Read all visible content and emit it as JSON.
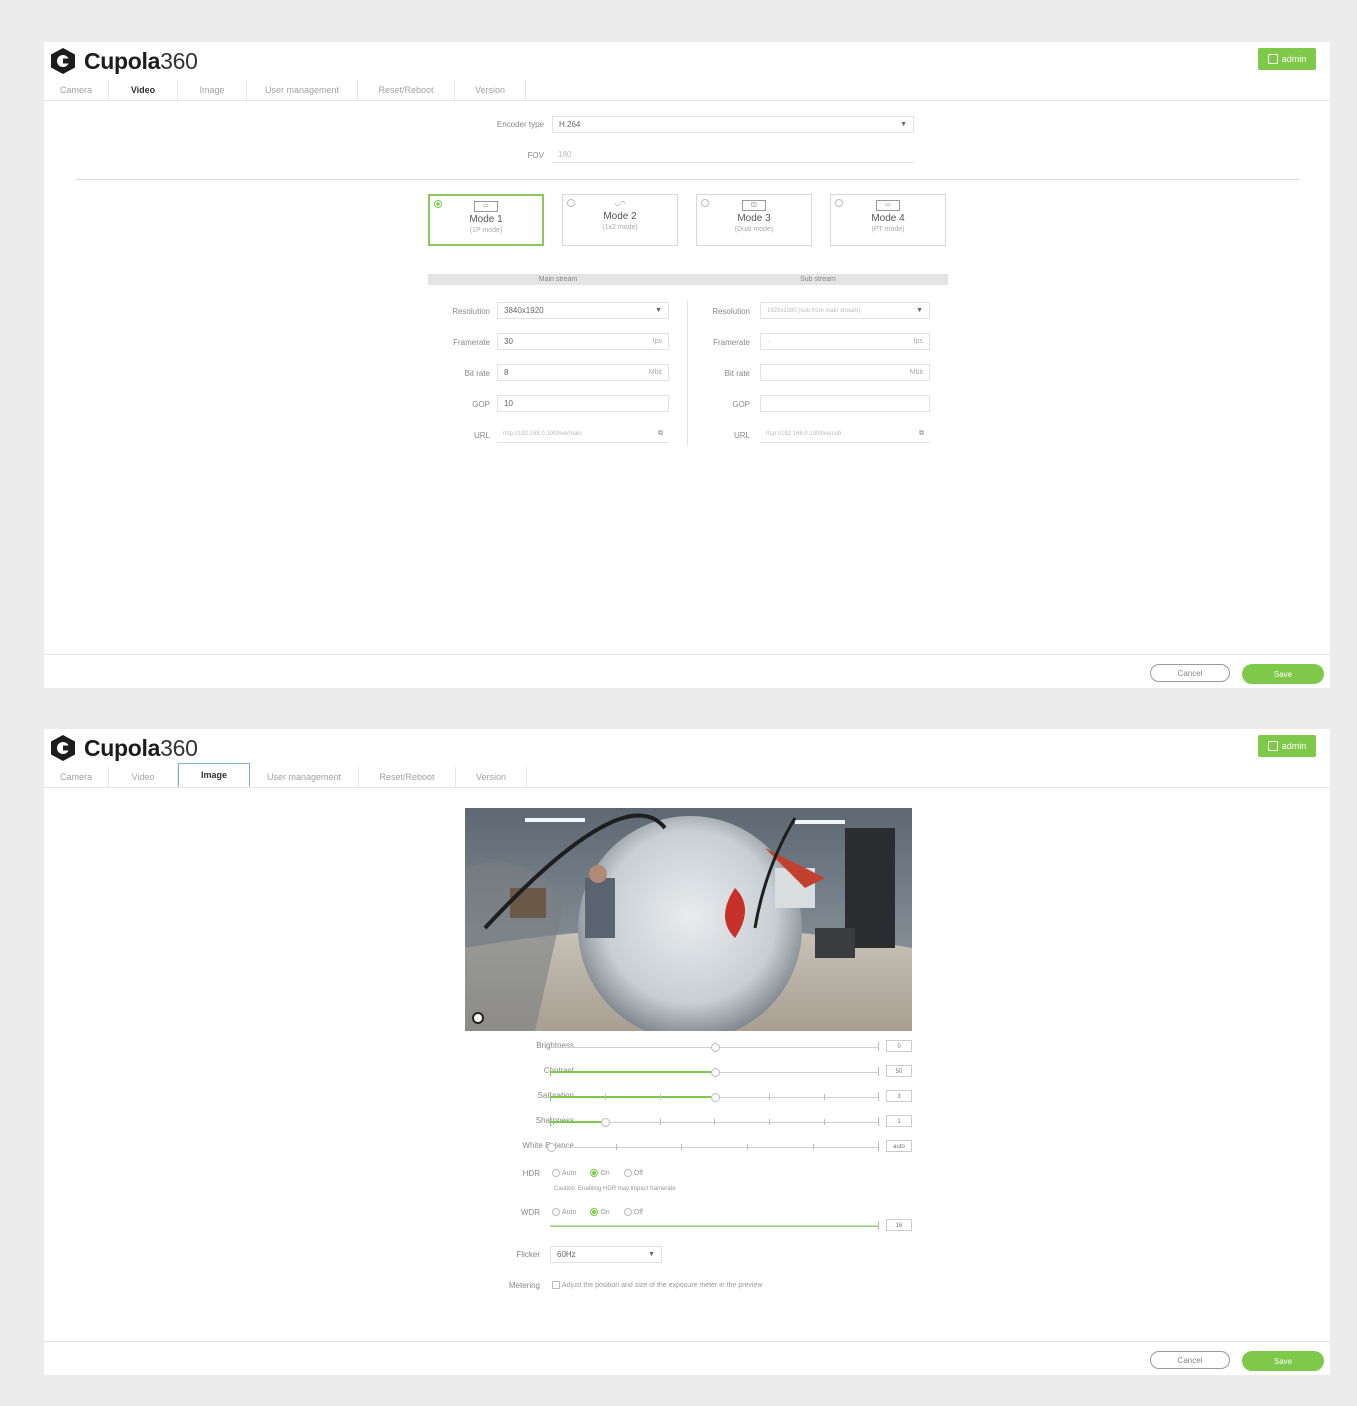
{
  "brand": {
    "bold": "Cupola",
    "light": "360"
  },
  "header": {
    "admin_label": "admin"
  },
  "tabs": [
    "Camera",
    "Video",
    "Image",
    "User management",
    "Reset/Reboot",
    "Version"
  ],
  "footer": {
    "cancel_label": "Cancel",
    "save_label": "Save"
  },
  "video_panel": {
    "active_tab": "Video",
    "encoder": {
      "label": "Encoder type",
      "value": "H.264"
    },
    "fov": {
      "label": "FOV",
      "value": "180"
    },
    "modes": [
      {
        "title": "Mode 1",
        "subtitle": "(1P mode)",
        "glyph": "▭",
        "selected": true
      },
      {
        "title": "Mode 2",
        "subtitle": "(1x2 mode)",
        "glyph": "◡◠",
        "selected": false
      },
      {
        "title": "Mode 3",
        "subtitle": "(Dual mode)",
        "glyph": "◫",
        "selected": false
      },
      {
        "title": "Mode 4",
        "subtitle": "(PT mode)",
        "glyph": "▭",
        "selected": false
      }
    ],
    "main_stream": {
      "header": "Main stream",
      "resolution_label": "Resolution",
      "resolution_value": "3840x1920",
      "framerate_label": "Framerate",
      "framerate_value": "30",
      "framerate_unit": "fps",
      "bitrate_label": "Bit rate",
      "bitrate_value": "8",
      "bitrate_unit": "Mbit",
      "gop_label": "GOP",
      "gop_value": "10",
      "url_label": "URL",
      "url_value": "rtsp://192.168.0.100/live/main"
    },
    "sub_stream": {
      "header": "Sub stream",
      "resolution_label": "Resolution",
      "resolution_value": "1920x1080 (sub from main stream)",
      "framerate_label": "Framerate",
      "framerate_value": "-",
      "framerate_unit": "fps",
      "bitrate_label": "Bit rate",
      "bitrate_value": "",
      "bitrate_unit": "Mbit",
      "gop_label": "GOP",
      "gop_value": "",
      "url_label": "URL",
      "url_value": "rtsp://192.168.0.100/live/sub"
    }
  },
  "image_panel": {
    "active_tab": "Image",
    "sliders": [
      {
        "label": "Brightness",
        "value": "0",
        "fraction": 0.5,
        "fill": false,
        "ticks": 0
      },
      {
        "label": "Contrast",
        "value": "50",
        "fraction": 0.5,
        "fill": true,
        "ticks": 0
      },
      {
        "label": "Saturation",
        "value": "3",
        "fraction": 0.5,
        "fill": true,
        "ticks": 5
      },
      {
        "label": "Sharpness",
        "value": "1",
        "fraction": 0.167,
        "fill": true,
        "ticks": 5
      },
      {
        "label": "White Balance",
        "value": "auto",
        "fraction": 0.0,
        "fill": false,
        "ticks": 4
      }
    ],
    "hdr": {
      "label": "HDR",
      "options": [
        "Auto",
        "On",
        "Off"
      ],
      "selected": "On",
      "note": "Caution: Enabling HDR may impact framerate"
    },
    "wdr": {
      "label": "WDR",
      "options": [
        "Auto",
        "On",
        "Off"
      ],
      "selected": "On",
      "value": "16",
      "fraction": 1.0
    },
    "flicker": {
      "label": "Flicker",
      "value": "60Hz"
    },
    "metering": {
      "label": "Metering",
      "text": "Adjust the position and size of the exposure meter in the preview"
    }
  }
}
